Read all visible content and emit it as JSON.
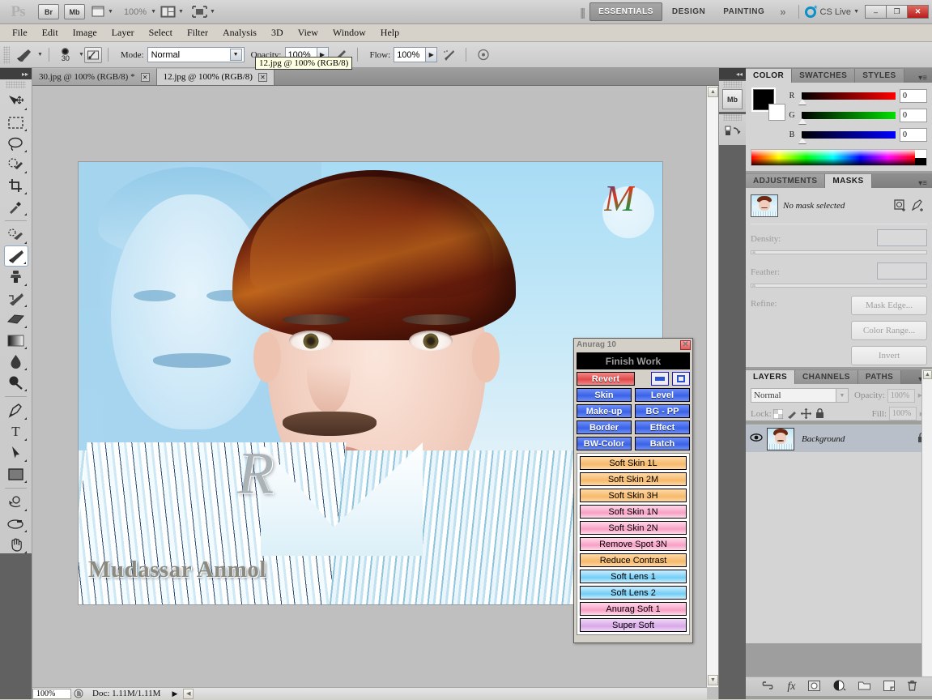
{
  "app": {
    "logo": "Ps",
    "zoom_display": "100%",
    "quick_buttons": [
      {
        "name": "bridge-button",
        "label": "Br"
      },
      {
        "name": "mini-bridge-button",
        "label": "Mb"
      }
    ],
    "workspaces": [
      "ESSENTIALS",
      "DESIGN",
      "PAINTING"
    ],
    "workspace_active": "ESSENTIALS",
    "workspace_more": "»",
    "cs_live": "CS Live",
    "window_buttons": {
      "minimize": "–",
      "restore": "❐",
      "close": "✕"
    }
  },
  "menubar": {
    "items": [
      "File",
      "Edit",
      "Image",
      "Layer",
      "Select",
      "Filter",
      "Analysis",
      "3D",
      "View",
      "Window",
      "Help"
    ]
  },
  "options_bar": {
    "brush_size": "30",
    "mode_label": "Mode:",
    "mode_value": "Normal",
    "opacity_label": "Opacity:",
    "opacity_value": "100%",
    "flow_label": "Flow:",
    "flow_value": "100%"
  },
  "tooltip": {
    "text": "12.jpg @ 100% (RGB/8)"
  },
  "document_tabs": [
    {
      "title": "30.jpg @ 100% (RGB/8) *",
      "close": "✕",
      "active": false
    },
    {
      "title": "12.jpg @ 100% (RGB/8)",
      "close": "✕",
      "active": true
    }
  ],
  "toolbox": {
    "collapse": "▸▸",
    "tools": [
      {
        "name": "move-tool",
        "glyph": "➤"
      },
      {
        "name": "marquee-tool",
        "glyph": "⬚"
      },
      {
        "name": "lasso-tool",
        "glyph": "○"
      },
      {
        "name": "quick-selection-tool",
        "glyph": "✒"
      },
      {
        "name": "crop-tool",
        "glyph": "⌗"
      },
      {
        "name": "eyedropper-tool",
        "glyph": "╱"
      },
      {
        "name": "spot-healing-brush-tool",
        "glyph": "✒"
      },
      {
        "name": "brush-tool",
        "glyph": "✎",
        "selected": true
      },
      {
        "name": "clone-stamp-tool",
        "glyph": "⚑"
      },
      {
        "name": "history-brush-tool",
        "glyph": "✐"
      },
      {
        "name": "eraser-tool",
        "glyph": "▰"
      },
      {
        "name": "gradient-tool",
        "glyph": "▤"
      },
      {
        "name": "blur-tool",
        "glyph": "●"
      },
      {
        "name": "dodge-tool",
        "glyph": "⚲"
      },
      {
        "name": "pen-tool",
        "glyph": "✑"
      },
      {
        "name": "type-tool",
        "glyph": "T"
      },
      {
        "name": "path-selection-tool",
        "glyph": "⮝"
      },
      {
        "name": "rectangle-tool",
        "glyph": "▢"
      },
      {
        "name": "3d-rotate-tool",
        "glyph": "◔"
      },
      {
        "name": "3d-orbit-tool",
        "glyph": "↺"
      },
      {
        "name": "hand-tool",
        "glyph": "✋"
      },
      {
        "name": "zoom-tool",
        "glyph": "⌕"
      }
    ],
    "swatch_reset": "◰",
    "swatch_swap": "⇄",
    "foreground_color": "#000000",
    "background_color": "#ffffff",
    "quick_mask": "◯"
  },
  "anurag_panel": {
    "title": "Anurag 10",
    "close": "✕",
    "finish_work": "Finish Work",
    "revert": "Revert",
    "mini_buttons": [
      "minimize-icon",
      "restore-icon"
    ],
    "grid_buttons": [
      [
        "Skin",
        "Level"
      ],
      [
        "Make-up",
        "BG - PP"
      ],
      [
        "Border",
        "Effect"
      ],
      [
        "BW-Color",
        "Batch"
      ]
    ],
    "actions": [
      {
        "label": "Soft Skin 1L",
        "color": "orange"
      },
      {
        "label": "Soft Skin 2M",
        "color": "orange"
      },
      {
        "label": "Soft Skin 3H",
        "color": "orange"
      },
      {
        "label": "Soft Skin 1N",
        "color": "pink"
      },
      {
        "label": "Soft Skin 2N",
        "color": "pink"
      },
      {
        "label": "Remove Spot 3N",
        "color": "pink"
      },
      {
        "label": "Reduce Contrast",
        "color": "orange"
      },
      {
        "label": "Soft Lens 1",
        "color": "cyan"
      },
      {
        "label": "Soft Lens 2",
        "color": "cyan"
      },
      {
        "label": "Anurag Soft 1",
        "color": "pink"
      },
      {
        "label": "Super Soft",
        "color": "violet"
      }
    ]
  },
  "dock_rail": {
    "collapse": "◂◂",
    "icons": [
      {
        "name": "mini-bridge-icon",
        "label": "Mb"
      },
      {
        "name": "history-icon",
        "label": "↺"
      }
    ]
  },
  "color_panel": {
    "tabs": [
      "COLOR",
      "SWATCHES",
      "STYLES"
    ],
    "active_tab": "COLOR",
    "menu": "▾≡",
    "channels": [
      {
        "label": "R",
        "value": "0"
      },
      {
        "label": "G",
        "value": "0"
      },
      {
        "label": "B",
        "value": "0"
      }
    ],
    "foreground": "#000000",
    "background": "#ffffff"
  },
  "masks_panel": {
    "tabs": [
      "ADJUSTMENTS",
      "MASKS"
    ],
    "active_tab": "MASKS",
    "menu": "▾≡",
    "status": "No mask selected",
    "header_icons": [
      "add-pixel-mask-icon",
      "add-vector-mask-icon"
    ],
    "density_label": "Density:",
    "density_value": "",
    "feather_label": "Feather:",
    "feather_value": "",
    "refine_label": "Refine:",
    "buttons": [
      "Mask Edge...",
      "Color Range...",
      "Invert"
    ],
    "footer_icons": [
      "load-selection-icon",
      "apply-mask-icon",
      "disable-mask-icon",
      "delete-mask-icon"
    ]
  },
  "layers_panel": {
    "tabs": [
      "LAYERS",
      "CHANNELS",
      "PATHS"
    ],
    "active_tab": "LAYERS",
    "menu": "▾≡",
    "blend_mode": "Normal",
    "opacity_label": "Opacity:",
    "opacity_value": "100%",
    "lock_label": "Lock:",
    "lock_icons": [
      "lock-transparency-icon",
      "lock-pixels-icon",
      "lock-position-icon",
      "lock-all-icon"
    ],
    "fill_label": "Fill:",
    "fill_value": "100%",
    "layers": [
      {
        "name": "Background",
        "visible": true,
        "locked": true
      }
    ],
    "footer_icons": [
      "link-layers-icon",
      "layer-style-icon",
      "layer-mask-icon",
      "adjustment-layer-icon",
      "new-group-icon",
      "new-layer-icon",
      "delete-layer-icon"
    ]
  },
  "status_bar": {
    "zoom": "100%",
    "doc_info": "Doc: 1.11M/1.11M",
    "arrow": "▶"
  },
  "image_content": {
    "watermark_name": "Mudassar Anmol",
    "monogram_r": "R",
    "monogram_m": "M"
  },
  "colors": {
    "accent_blue": "#3b63e8",
    "revert_red": "#e24a4a",
    "cs_live_blue": "#0a91c8",
    "close_red": "#b81c1c"
  }
}
